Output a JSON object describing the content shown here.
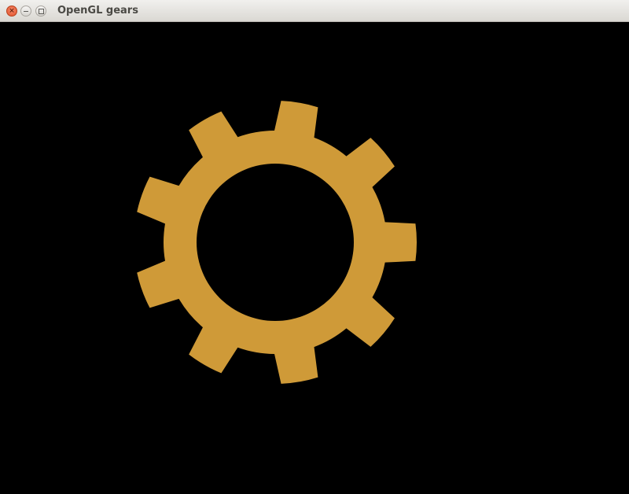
{
  "window": {
    "title": "OpenGL gears",
    "controls": {
      "close_icon": "close-icon",
      "minimize_icon": "minimize-icon",
      "maximize_icon": "maximize-icon"
    }
  },
  "scene": {
    "background_color": "#000000",
    "gear": {
      "color": "#cf9a38",
      "teeth": 9
    }
  }
}
